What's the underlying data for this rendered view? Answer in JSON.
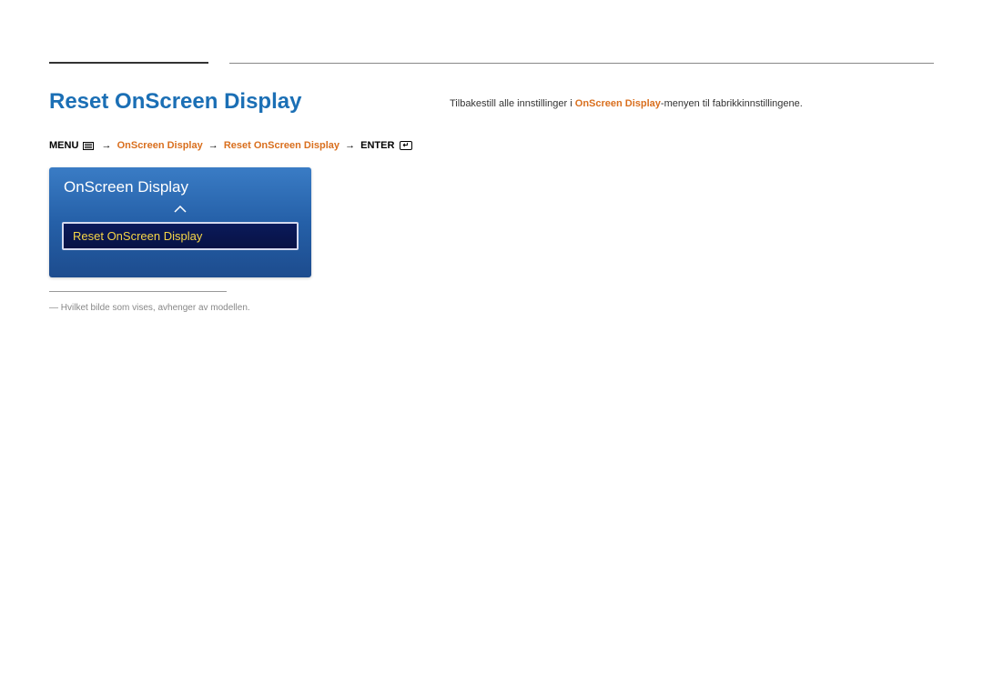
{
  "section_title": "Reset OnScreen Display",
  "breadcrumb": {
    "menu_label": "MENU",
    "path1": "OnScreen Display",
    "path2": "Reset OnScreen Display",
    "enter_label": "ENTER"
  },
  "menu_box": {
    "title": "OnScreen Display",
    "selected_item": "Reset OnScreen Display"
  },
  "footnote": "― Hvilket bilde som vises, avhenger av modellen.",
  "description": {
    "text_before": "Tilbakestill alle innstillinger i ",
    "highlighted": "OnScreen Display",
    "text_after": "-menyen til fabrikkinnstillingene."
  }
}
